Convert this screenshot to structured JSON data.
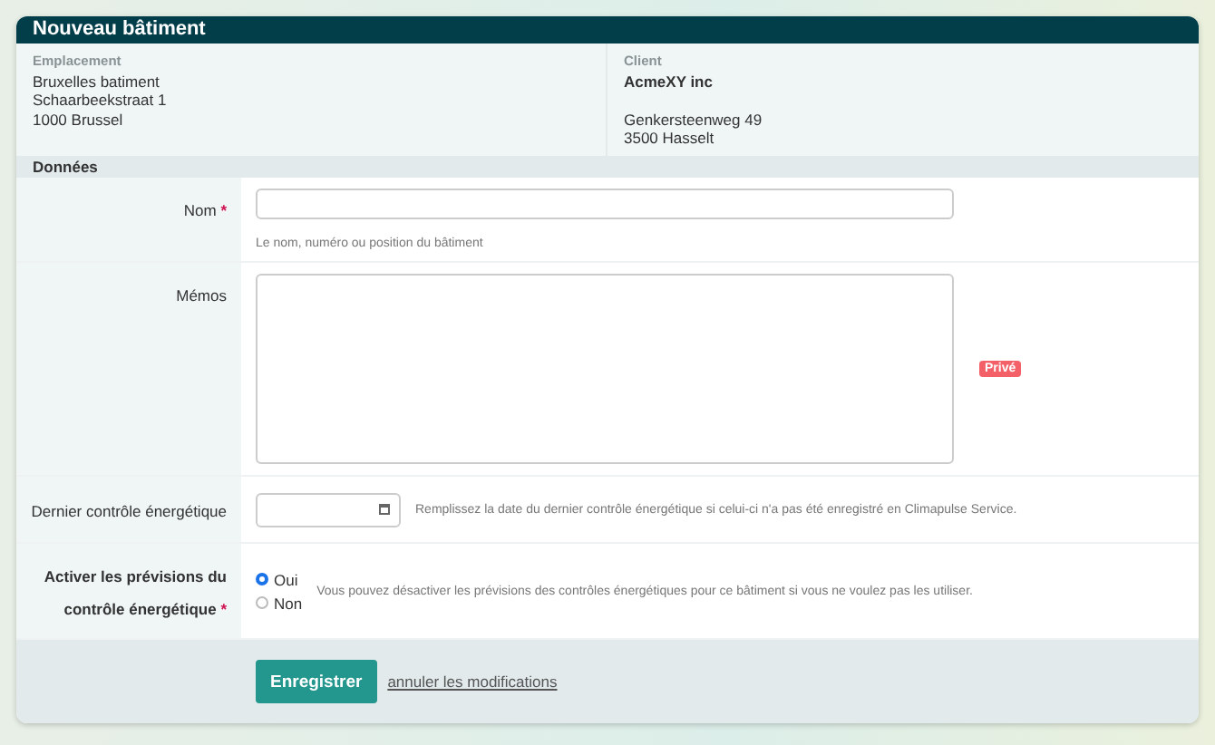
{
  "window": {
    "title": "Nouveau bâtiment"
  },
  "info": [
    {
      "label": "Emplacement",
      "lines": [
        "Bruxelles batiment",
        "Schaarbeekstraat 1",
        "1000 Brussel"
      ]
    },
    {
      "label": "Client",
      "name": "AcmeXY inc",
      "lines": [
        "Genkersteenweg 49",
        "3500 Hasselt"
      ]
    }
  ],
  "section": "Données",
  "required_mark": "*",
  "fields": [
    {
      "kind": "text",
      "label": "Nom",
      "required": true,
      "help": "Le nom, numéro ou position du bâtiment"
    },
    {
      "kind": "textarea",
      "label": "Mémos",
      "required": false,
      "badge": "Privé"
    },
    {
      "kind": "date",
      "label": "Dernier contrôle énergétique",
      "required": false,
      "help": "Remplissez la date du dernier contrôle énergétique si celui-ci n'a pas été enregistré en Climapulse Service."
    },
    {
      "kind": "radio",
      "label": "Activer les prévisions du contrôle énergétique",
      "required": true,
      "options": [
        {
          "label": "Oui",
          "selected": true
        },
        {
          "label": "Non",
          "selected": false
        }
      ],
      "help": "Vous pouvez désactiver les prévisions des contrôles énergétiques pour ce bâtiment si vous ne voulez pas les utiliser."
    }
  ],
  "footer": {
    "save": "Enregistrer",
    "cancel": "annuler les modifications"
  }
}
